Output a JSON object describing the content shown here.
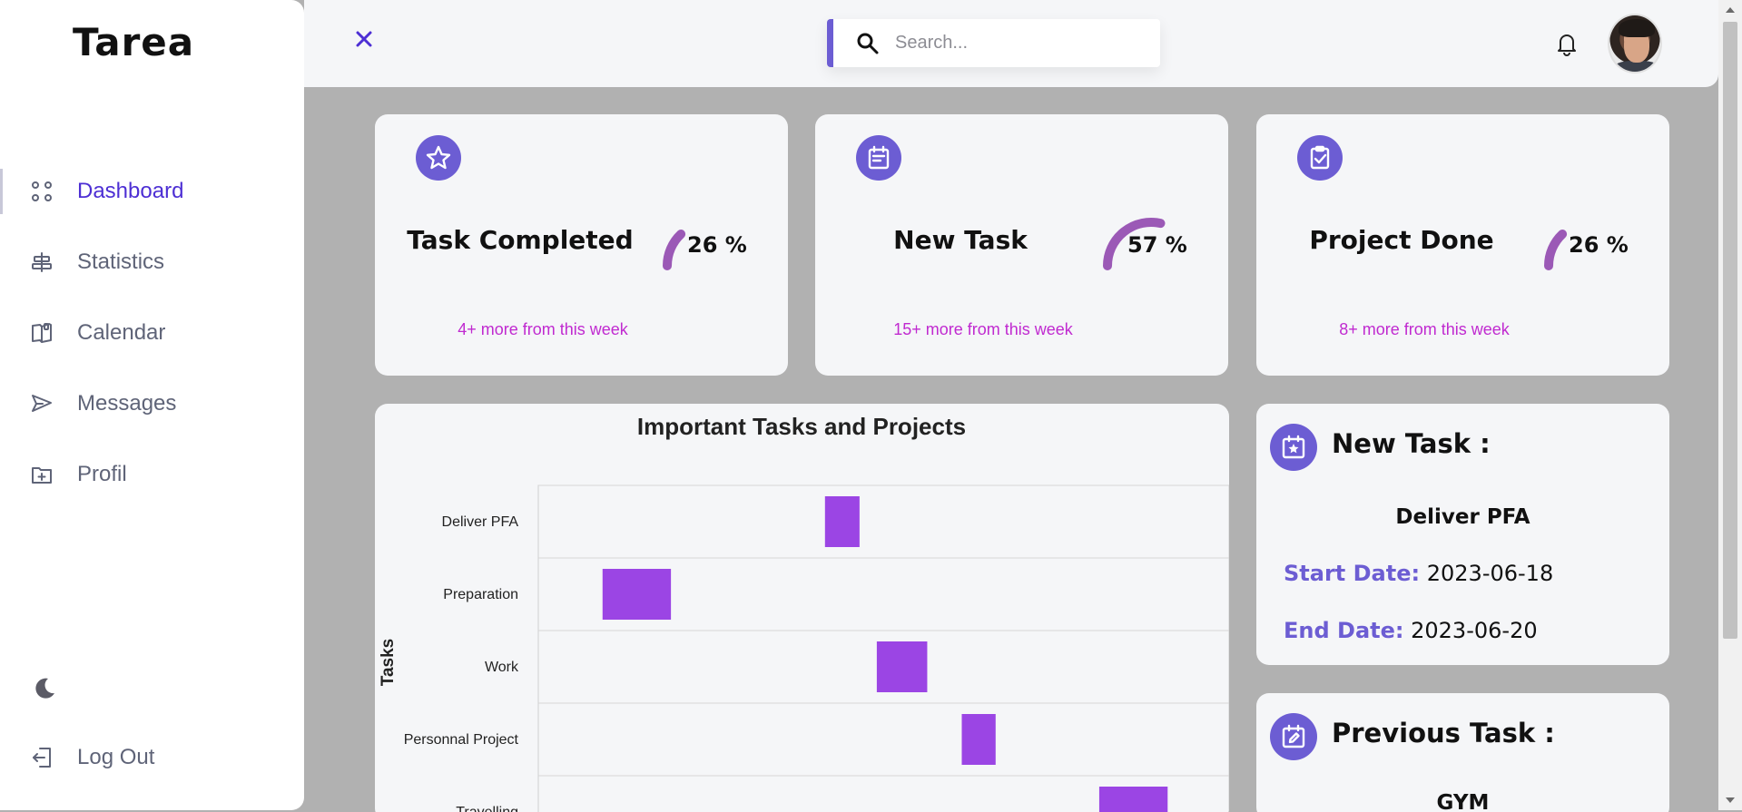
{
  "app": {
    "logo": "Tarea"
  },
  "sidebar": {
    "items": [
      {
        "label": "Dashboard",
        "icon": "grid-dots-icon",
        "active": true
      },
      {
        "label": "Statistics",
        "icon": "align-center-icon",
        "active": false
      },
      {
        "label": "Calendar",
        "icon": "book-open-icon",
        "active": false
      },
      {
        "label": "Messages",
        "icon": "send-icon",
        "active": false
      },
      {
        "label": "Profil",
        "icon": "folder-add-icon",
        "active": false
      }
    ],
    "theme_toggle_icon": "moon-icon",
    "logout_label": "Log Out"
  },
  "topbar": {
    "search_placeholder": "Search...",
    "search_value": "",
    "close_icon": "close-icon",
    "notification_icon": "bell-icon"
  },
  "stats": [
    {
      "title": "Task Completed",
      "percent": 26,
      "percent_label": "26 %",
      "more": "4+ more from this week",
      "icon": "star-icon"
    },
    {
      "title": "New Task",
      "percent": 57,
      "percent_label": "57 %",
      "more": "15+ more from this week",
      "icon": "calendar-note-icon"
    },
    {
      "title": "Project Done",
      "percent": 26,
      "percent_label": "26 %",
      "more": "8+ more from this week",
      "icon": "clipboard-check-icon"
    }
  ],
  "chart_data": {
    "type": "bar",
    "orientation": "timeline",
    "title": "Important Tasks and Projects",
    "ylabel": "Tasks",
    "xlabel": "",
    "categories": [
      "Deliver PFA",
      "Preparation",
      "Work",
      "Personnal Project",
      "Travelling"
    ],
    "series": [
      {
        "values": [
          {
            "start": 0.415,
            "end": 0.465
          },
          {
            "start": 0.093,
            "end": 0.192
          },
          {
            "start": 0.49,
            "end": 0.563
          },
          {
            "start": 0.613,
            "end": 0.662
          },
          {
            "start": 0.812,
            "end": 0.911
          }
        ]
      }
    ],
    "xlim": [
      0,
      1
    ],
    "bar_color": "#9b45e4",
    "grid": true
  },
  "new_task": {
    "heading": "New Task :",
    "name": "Deliver PFA",
    "start_label": "Start Date:",
    "start_value": "2023-06-18",
    "end_label": "End Date:",
    "end_value": "2023-06-20",
    "icon": "calendar-star-icon"
  },
  "previous_task": {
    "heading": "Previous Task :",
    "name": "GYM",
    "icon": "calendar-edit-icon"
  },
  "colors": {
    "accent": "#6c5dd3",
    "active_nav": "#4d2fd4",
    "gauge": "#9b59b6",
    "more_text": "#c02ad0",
    "bar": "#9b45e4"
  }
}
